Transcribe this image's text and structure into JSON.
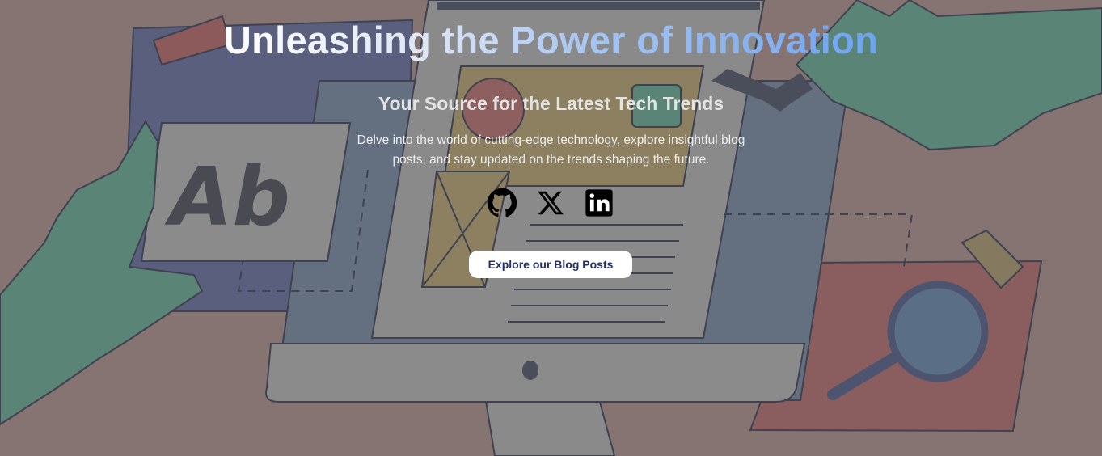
{
  "hero": {
    "title": "Unleashing the Power of Innovation",
    "subtitle": "Your Source for the Latest Tech Trends",
    "description": "Delve into the world of cutting-edge technology, explore insightful blog posts, and stay updated on the trends shaping the future.",
    "cta_label": "Explore our Blog Posts"
  },
  "illustration": {
    "card_text": "Ab"
  },
  "social_links": [
    {
      "name": "github",
      "icon": "github-icon"
    },
    {
      "name": "x",
      "icon": "x-icon"
    },
    {
      "name": "linkedin",
      "icon": "linkedin-icon"
    }
  ],
  "colors": {
    "overlay_bg": "#857472",
    "button_bg": "#ffffff",
    "button_text": "#24306b",
    "title_gradient_end": "#6da3ef",
    "hand_green": "#5a8475",
    "monitor_gray": "#8a8a8a",
    "screen_blue": "#64707f"
  }
}
